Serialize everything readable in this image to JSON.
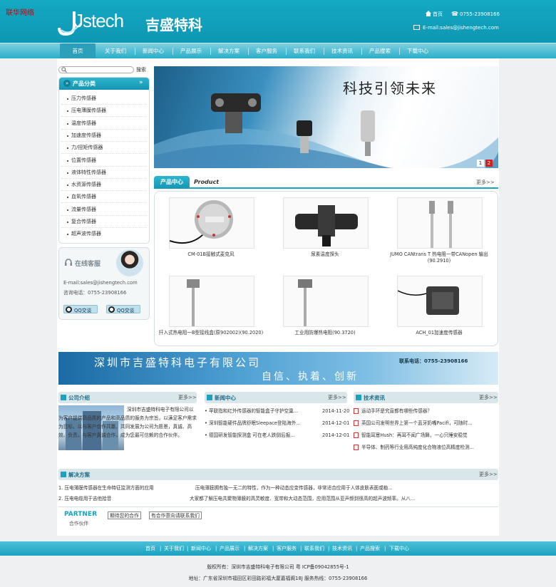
{
  "site": {
    "corner_label": "联华网络",
    "logo_text": "Jstech",
    "logo_cn": "吉盛特科",
    "home_link": "首页",
    "phone": "0755-23908166",
    "email_line": "E-mail:sales@jishengtech.com"
  },
  "nav": [
    "首页",
    "关于我们",
    "新闻中心",
    "产品展示",
    "解决方案",
    "客户服务",
    "联系我们",
    "技术资讯",
    "产品搜索",
    "下载中心"
  ],
  "search": {
    "button": "搜索",
    "placeholder": ""
  },
  "categories": {
    "title": "产品分类",
    "items": [
      "压力传感器",
      "压电薄膜传感器",
      "温度传感器",
      "加速度传感器",
      "力/扭矩传感器",
      "位置传感器",
      "液体特性传感器",
      "水资源传感器",
      "血氧传感器",
      "流量传感器",
      "复合传感器",
      "超声波传感器"
    ]
  },
  "service": {
    "title": "在线客服",
    "email": "E-mail:sales@jishengtech.com",
    "phone_line": "咨询电话：0755-23908166",
    "qq1": "QQ交谈",
    "qq2": "QQ交谈"
  },
  "banner": {
    "slogan": "科技引领未来",
    "slide1": "1",
    "slide2": "2"
  },
  "product_center": {
    "tab": "产品中心",
    "tab_en": "Product",
    "more": "更多>>",
    "items": [
      {
        "caption": "CM-01B接触式麦克风"
      },
      {
        "caption": "尿素温度探头"
      },
      {
        "caption": "JUMO CANtrans T 热电阻一带CANopen 输出(90.2910)"
      },
      {
        "caption": "扦入式热电阻一B型接线盒(原902002)(90.2020)"
      },
      {
        "caption": "工业用防爆热电阻(90.3720)"
      },
      {
        "caption": "ACH_01加速度传感器"
      }
    ]
  },
  "banner2": {
    "company": "深圳市吉盛特科电子有限公司",
    "motto": "自信、执着、创新",
    "hotline": "联系电话：0755-23908166"
  },
  "about": {
    "title": "公司介绍",
    "more": "更多>>",
    "text": "深圳市吉盛特科电子有限公司以为客户提供高品质的产品和高品质的服务为宗旨，以满足客户需求为目标，以与客户合作共赢、共同发展为公司为愿景，真诚、高效、负责，与客户真诚合作，成为您最可信赖的合作伙伴。"
  },
  "news": {
    "title": "新闻中心",
    "more": "更多>>",
    "items": [
      {
        "text": "• 苹联指和红外传感器的智能盒子守护空巢...",
        "date": "2014-11-20"
      },
      {
        "text": "• 深圳智能硬件品牌舒眠Sleepace登陆海外...",
        "date": "2014-12-01"
      },
      {
        "text": "• 德国研发智能探测盒 可在老人跌倒后报...",
        "date": "2014-12-01"
      }
    ]
  },
  "tech": {
    "title": "技术资讯",
    "more": "更多>>",
    "items": [
      "运动手环是究竟都有哪些传感器？",
      "英国公司发明世界上第一个蓝牙奶嘴Pacifi，可随时...",
      "智能耳塞Hush：再耳不闻广场舞，一心只睡安稳觉",
      "半导体、制药等行业用高纯度化合物液位高精度检测..."
    ]
  },
  "solutions": {
    "title": "解决方案",
    "more": "更多>>",
    "items": [
      {
        "left": "1. 压电薄膜传感器在生命特征监测方面的应用",
        "right": "压电薄膜拥有独一无二的特性，作为一种动态应变传感器，非常适合应用于人体皮肤表面或植..."
      },
      {
        "left": "2. 压电电缆用于吉他拾音",
        "right": "大家都了解压电共聚物薄膜的高灵敏度、宽带和大动态范围，应用范围从亚声频到很高的超声波频率。从八..."
      }
    ]
  },
  "partner": {
    "title": "PARTNER",
    "subtitle": "合作伙伴",
    "btn1": "期待您的合作",
    "btn2": "有合作意向请联系我们"
  },
  "footer": {
    "links": [
      "首页",
      "关于我们",
      "新闻中心",
      "产品展示",
      "解决方案",
      "客户服务",
      "联系我们",
      "技术资讯",
      "产品搜索",
      "下载中心"
    ],
    "copyright": "版权所有：深圳市吉盛特科电子有限公司 粤 ICP备09042855号-1",
    "address": "地址：广东省深圳市福田区彩田路彩福大厦嘉福阁18J 服务热线：0755-23908166"
  }
}
